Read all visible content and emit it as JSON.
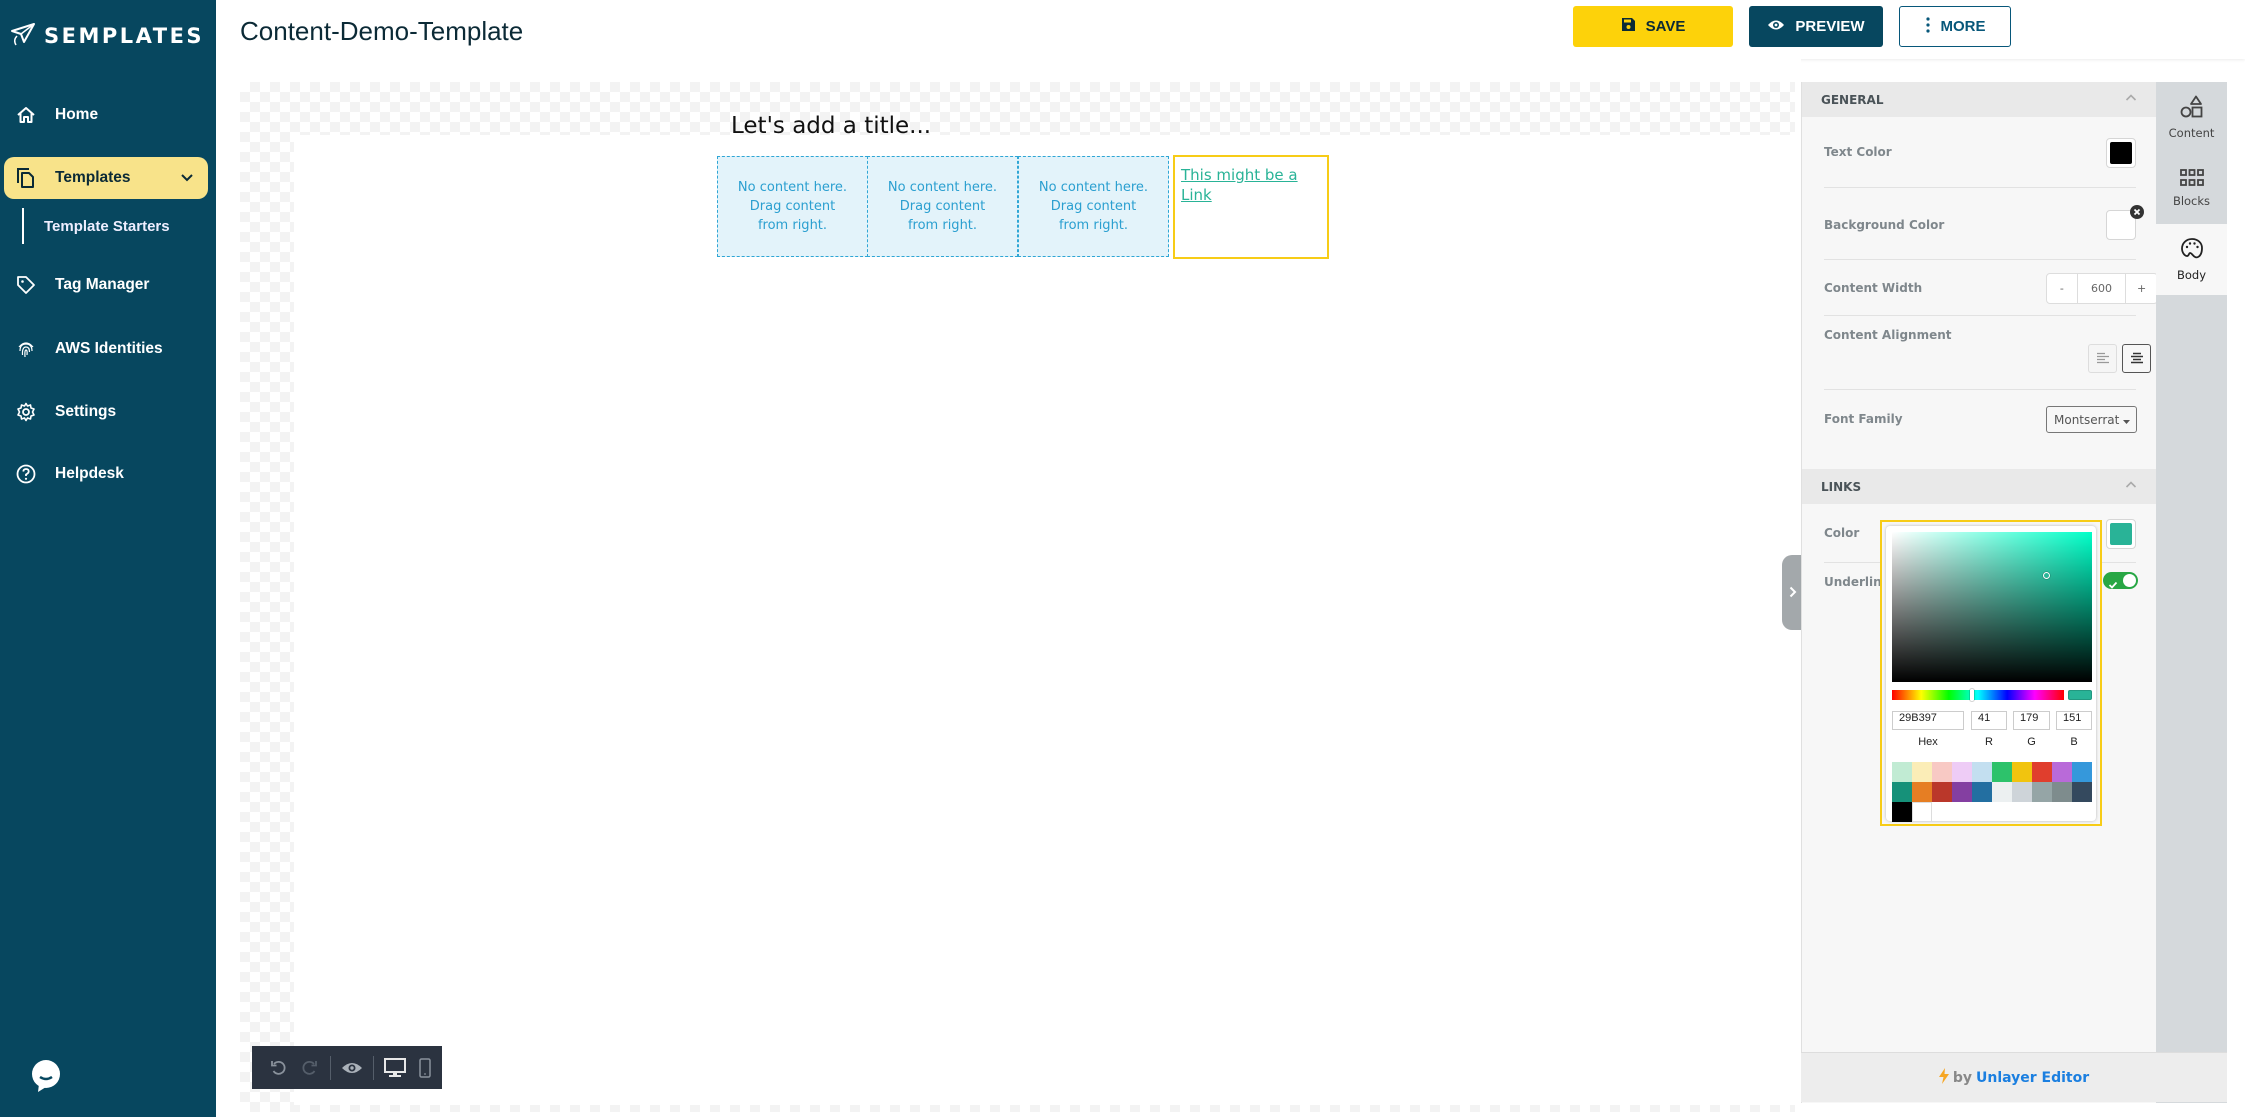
{
  "app": {
    "brand": "SEMPLATES",
    "page_title": "Content-Demo-Template"
  },
  "sidebar": {
    "items": [
      {
        "label": "Home",
        "icon": "home-icon"
      },
      {
        "label": "Templates",
        "icon": "templates-icon",
        "active": true
      },
      {
        "label": "Tag Manager",
        "icon": "tag-icon"
      },
      {
        "label": "AWS Identities",
        "icon": "fingerprint-icon"
      },
      {
        "label": "Settings",
        "icon": "gear-icon"
      },
      {
        "label": "Helpdesk",
        "icon": "help-icon"
      }
    ],
    "sub_items": [
      {
        "label": "Template Starters"
      }
    ]
  },
  "header": {
    "save_label": "SAVE",
    "preview_label": "PREVIEW",
    "more_label": "MORE"
  },
  "canvas": {
    "title": "Let's add a title...",
    "columns": [
      {
        "lines": [
          "No content here.",
          "Drag content",
          "from right."
        ]
      },
      {
        "lines": [
          "No content here.",
          "Drag content",
          "from right."
        ]
      },
      {
        "lines": [
          "No content here.",
          "Drag content",
          "from right."
        ]
      }
    ],
    "link_text": "This might be a Link ",
    "link_color": "#29B397",
    "selection_color": "#F7CC17"
  },
  "panel": {
    "general": {
      "heading": "GENERAL",
      "text_color_label": "Text Color",
      "text_color": "#000000",
      "background_color_label": "Background Color",
      "background_color": "#FFFFFF",
      "content_width_label": "Content Width",
      "content_width_minus": "-",
      "content_width_value": "600",
      "content_width_plus": "+",
      "content_alignment_label": "Content Alignment",
      "content_alignment": "center",
      "font_family_label": "Font Family",
      "font_family_value": "Montserrat"
    },
    "links": {
      "heading": "LINKS",
      "color_label": "Color",
      "color": "#29B397",
      "underline_label": "Underline",
      "underline": true
    }
  },
  "color_picker": {
    "hex": "29B397",
    "r": "41",
    "g": "179",
    "b": "151",
    "hex_label": "Hex",
    "r_label": "R",
    "g_label": "G",
    "b_label": "B",
    "presets": [
      "#C1EBD3",
      "#FBEDB7",
      "#F8C9C4",
      "#EECCF6",
      "#C3DFF0",
      "#2DC26B",
      "#F1C40F",
      "#E03E2D",
      "#B96AD9",
      "#3598DB",
      "#169179",
      "#E67E23",
      "#BA372A",
      "#843FA1",
      "#236FA1",
      "#ECF0F1",
      "#CED4D9",
      "#95A5A6",
      "#7E8C8D",
      "#34495E",
      "#000000",
      "#FFFFFF"
    ]
  },
  "tabs": [
    {
      "label": "Content",
      "icon": "shapes-icon"
    },
    {
      "label": "Blocks",
      "icon": "blocks-grid-icon"
    },
    {
      "label": "Body",
      "icon": "palette-icon",
      "active": true
    }
  ],
  "footer": {
    "by": "by",
    "brand": "Unlayer Editor"
  }
}
